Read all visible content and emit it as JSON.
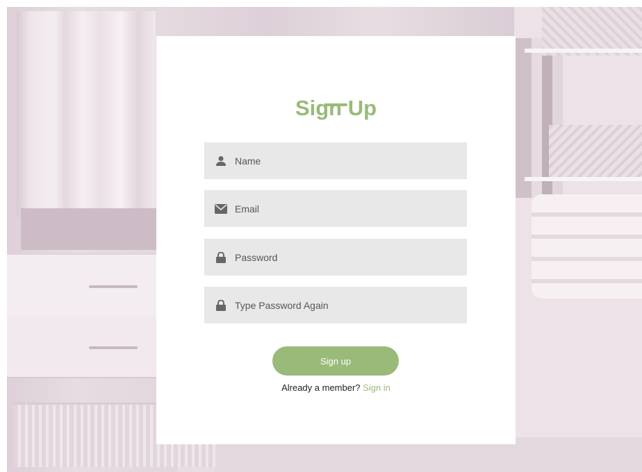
{
  "form": {
    "title": "Sign Up",
    "fields": [
      {
        "placeholder": "Name",
        "icon": "user-icon",
        "value": ""
      },
      {
        "placeholder": "Email",
        "icon": "envelope-icon",
        "value": ""
      },
      {
        "placeholder": "Password",
        "icon": "lock-icon",
        "value": ""
      },
      {
        "placeholder": "Type Password Again",
        "icon": "lock-icon",
        "value": ""
      }
    ],
    "submit_label": "Sign up",
    "member_prompt": "Already a member?",
    "signin_link": "Sign in"
  },
  "colors": {
    "accent": "#99ba79",
    "field_background": "#e8e8e8",
    "icon": "#666666",
    "card_background": "#ffffff",
    "page_background": "#e9dde4"
  }
}
